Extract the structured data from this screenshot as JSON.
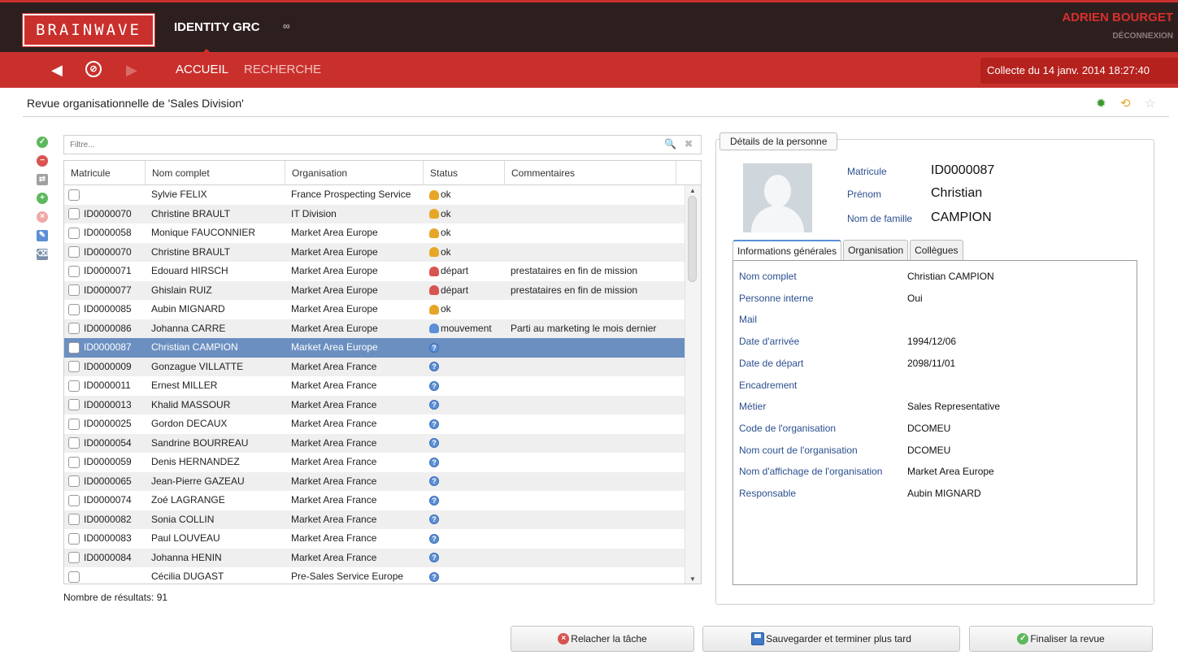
{
  "header": {
    "logo_text": "BRAINWAVE",
    "app_title": "IDENTITY GRC",
    "app_glyph": "∞",
    "user_name": "ADRIEN BOURGET",
    "logout_label": "DÉCONNEXION"
  },
  "nav": {
    "back_glyph": "◀",
    "forward_glyph": "▶",
    "compass_glyph": "⊘",
    "home_label": "ACCUEIL",
    "search_label": "RECHERCHE",
    "collect_label": "Collecte du 14 janv. 2014 18:27:40"
  },
  "page": {
    "title": "Revue organisationnelle de 'Sales Division'",
    "results_count": "Nombre de résultats: 91"
  },
  "filter": {
    "placeholder": "Filtre...",
    "search_glyph": "🔍",
    "clear_glyph": "✖"
  },
  "table": {
    "headers": [
      "Matricule",
      "Nom complet",
      "Organisation",
      "Status",
      "Commentaires"
    ],
    "rows": [
      {
        "id": "",
        "name": "Sylvie FELIX",
        "org": "France Prospecting Service",
        "status": "ok",
        "comment": ""
      },
      {
        "id": "ID0000070",
        "name": "Christine BRAULT",
        "org": "IT Division",
        "status": "ok",
        "comment": ""
      },
      {
        "id": "ID0000058",
        "name": "Monique FAUCONNIER",
        "org": "Market Area Europe",
        "status": "ok",
        "comment": ""
      },
      {
        "id": "ID0000070",
        "name": "Christine BRAULT",
        "org": "Market Area Europe",
        "status": "ok",
        "comment": ""
      },
      {
        "id": "ID0000071",
        "name": "Edouard HIRSCH",
        "org": "Market Area Europe",
        "status": "départ",
        "comment": "prestataires en fin de mission"
      },
      {
        "id": "ID0000077",
        "name": "Ghislain RUIZ",
        "org": "Market Area Europe",
        "status": "départ",
        "comment": "prestataires en fin de mission"
      },
      {
        "id": "ID0000085",
        "name": "Aubin MIGNARD",
        "org": "Market Area Europe",
        "status": "ok",
        "comment": ""
      },
      {
        "id": "ID0000086",
        "name": "Johanna CARRE",
        "org": "Market Area Europe",
        "status": "mouvement",
        "comment": "Parti au marketing le mois dernier"
      },
      {
        "id": "ID0000087",
        "name": "Christian CAMPION",
        "org": "Market Area Europe",
        "status": "?",
        "comment": ""
      },
      {
        "id": "ID0000009",
        "name": "Gonzague VILLATTE",
        "org": "Market Area France",
        "status": "?",
        "comment": ""
      },
      {
        "id": "ID0000011",
        "name": "Ernest MILLER",
        "org": "Market Area France",
        "status": "?",
        "comment": ""
      },
      {
        "id": "ID0000013",
        "name": "Khalid MASSOUR",
        "org": "Market Area France",
        "status": "?",
        "comment": ""
      },
      {
        "id": "ID0000025",
        "name": "Gordon DECAUX",
        "org": "Market Area France",
        "status": "?",
        "comment": ""
      },
      {
        "id": "ID0000054",
        "name": "Sandrine BOURREAU",
        "org": "Market Area France",
        "status": "?",
        "comment": ""
      },
      {
        "id": "ID0000059",
        "name": "Denis HERNANDEZ",
        "org": "Market Area France",
        "status": "?",
        "comment": ""
      },
      {
        "id": "ID0000065",
        "name": "Jean-Pierre GAZEAU",
        "org": "Market Area France",
        "status": "?",
        "comment": ""
      },
      {
        "id": "ID0000074",
        "name": "Zoé LAGRANGE",
        "org": "Market Area France",
        "status": "?",
        "comment": ""
      },
      {
        "id": "ID0000082",
        "name": "Sonia COLLIN",
        "org": "Market Area France",
        "status": "?",
        "comment": ""
      },
      {
        "id": "ID0000083",
        "name": "Paul LOUVEAU",
        "org": "Market Area France",
        "status": "?",
        "comment": ""
      },
      {
        "id": "ID0000084",
        "name": "Johanna HENIN",
        "org": "Market Area France",
        "status": "?",
        "comment": ""
      },
      {
        "id": "",
        "name": "Cécilia DUGAST",
        "org": "Pre-Sales Service Europe",
        "status": "?",
        "comment": ""
      }
    ],
    "selected_index": 8
  },
  "details": {
    "legend": "Détails de la personne",
    "matricule_label": "Matricule",
    "matricule_value": "ID0000087",
    "prenom_label": "Prénom",
    "prenom_value": "Christian",
    "nom_label": "Nom de famille",
    "nom_value": "CAMPION",
    "tabs": [
      "Informations générales",
      "Organisation",
      "Collègues"
    ],
    "fields": [
      {
        "label": "Nom complet",
        "value": "Christian CAMPION"
      },
      {
        "label": "Personne interne",
        "value": "Oui"
      },
      {
        "label": "Mail",
        "value": ""
      },
      {
        "label": "Date d'arrivée",
        "value": "1994/12/06"
      },
      {
        "label": "Date de départ",
        "value": "2098/11/01"
      },
      {
        "label": "Encadrement",
        "value": ""
      },
      {
        "label": "Métier",
        "value": "Sales Representative"
      },
      {
        "label": "Code de l'organisation",
        "value": "DCOMEU"
      },
      {
        "label": "Nom court de l'organisation",
        "value": "DCOMEU"
      },
      {
        "label": "Nom d'affichage de l'organisation",
        "value": "Market Area Europe"
      },
      {
        "label": "Responsable",
        "value": "Aubin MIGNARD"
      }
    ]
  },
  "buttons": {
    "release": "Relacher la tâche",
    "save": "Sauvegarder et terminer plus tard",
    "finalize": "Finaliser la revue"
  },
  "colors": {
    "brand_red": "#c9302c",
    "header_dark": "#2e1f1f",
    "selection_blue": "#6b8fc0",
    "status_ok": "#e8a628",
    "status_unknown": "#5b8fd6"
  }
}
